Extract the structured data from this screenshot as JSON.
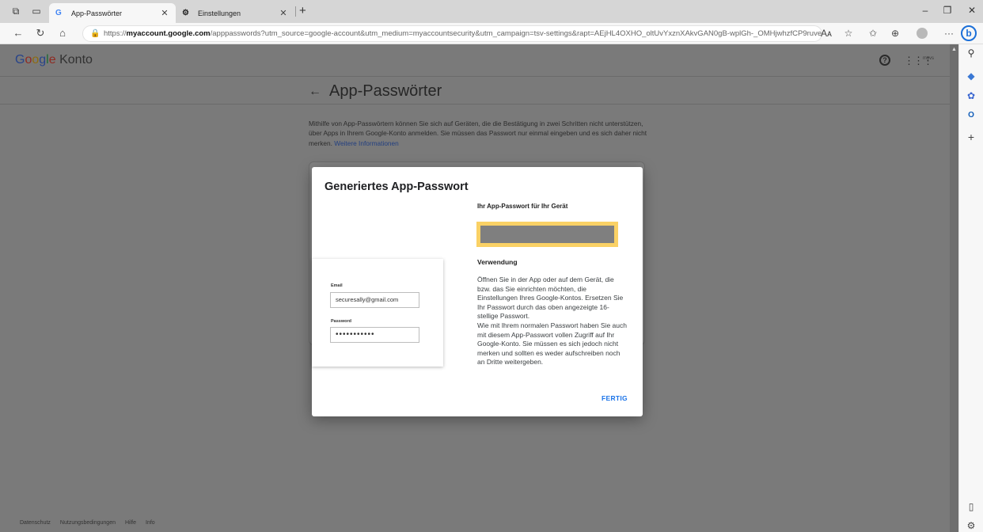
{
  "browser": {
    "tabs": [
      {
        "label": "App-Passwörter",
        "favicon": "G"
      },
      {
        "label": "Einstellungen",
        "favicon": "gear-icon"
      }
    ],
    "url_prefix": "https://",
    "url_host": "myaccount.google.com",
    "url_rest": "/apppasswords?utm_source=google-account&utm_medium=myaccountsecurity&utm_campaign=tsv-settings&rapt=AEjHL4OXHO_oltUvYxznXAkvGAN0gB-wplGh-_OMHjwhzfCP9ruve2Oi...",
    "read_aloud": "Aᴀ",
    "more": "···"
  },
  "google": {
    "logo": [
      "G",
      "o",
      "o",
      "g",
      "l",
      "e"
    ],
    "product": "Konto",
    "account_thumb": "myvs"
  },
  "page": {
    "title": "App-Passwörter",
    "intro": "Mithilfe von App-Passwörtern können Sie sich auf Geräten, die die Bestätigung in zwei Schritten nicht unterstützen, über Apps in Ihrem Google-Konto anmelden. Sie müssen das Passwort nur einmal eingeben und es sich daher nicht merken.",
    "intro_link": "Weitere Informationen"
  },
  "footer": [
    "Datenschutz",
    "Nutzungsbedingungen",
    "Hilfe",
    "Info"
  ],
  "dialog": {
    "title": "Generiertes App-Passwort",
    "demo": {
      "email_label": "Email",
      "email_value": "securesally@gmail.com",
      "password_label": "Password",
      "password_value": "•••••••••••"
    },
    "pw_heading": "Ihr App-Passwort für Ihr Gerät",
    "use_heading": "Verwendung",
    "use_text": "Öffnen Sie in der App oder auf dem Gerät, die bzw. das Sie einrichten möchten, die Einstellungen Ihres Google-Kontos. Ersetzen Sie Ihr Passwort durch das oben angezeigte 16-stellige Passwort.\nWie mit Ihrem normalen Passwort haben Sie auch mit diesem App-Passwort vollen Zugriff auf Ihr Google-Konto. Sie müssen es sich jedoch nicht merken und sollten es weder aufschreiben noch an Dritte weitergeben.",
    "done_button": "FERTIG"
  },
  "colors": {
    "overlay": "#7a7a7a",
    "password_highlight": "#fad165",
    "accent": "#1a73e8"
  }
}
